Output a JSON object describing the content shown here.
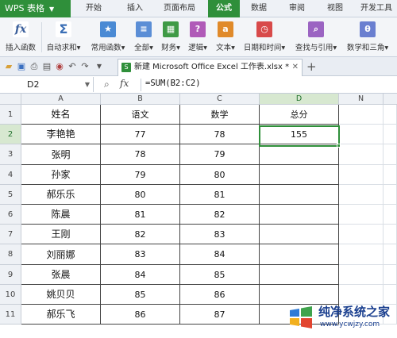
{
  "app": {
    "title": "WPS 表格"
  },
  "menu": {
    "tabs": [
      {
        "label": "开始"
      },
      {
        "label": "插入"
      },
      {
        "label": "页面布局"
      },
      {
        "label": "公式",
        "active": true
      },
      {
        "label": "数据"
      },
      {
        "label": "审阅"
      },
      {
        "label": "视图"
      },
      {
        "label": "开发工具"
      }
    ]
  },
  "ribbon": {
    "buttons": [
      {
        "label": "插入函数",
        "icon": "fx-icon",
        "color": "#5b7fb8"
      },
      {
        "label": "自动求和",
        "icon": "sigma-icon",
        "color": "#3b6fb6"
      },
      {
        "label": "常用函数",
        "icon": "star-icon",
        "color": "#4a8ad4"
      },
      {
        "label": "全部",
        "icon": "list-icon",
        "color": "#5b8ed6"
      },
      {
        "label": "财务",
        "icon": "finance-icon",
        "color": "#3f9a46"
      },
      {
        "label": "逻辑",
        "icon": "logic-icon",
        "color": "#b05ab8"
      },
      {
        "label": "文本",
        "icon": "text-icon",
        "color": "#e08a2a"
      },
      {
        "label": "日期和时间",
        "icon": "clock-icon",
        "color": "#d84a4a"
      },
      {
        "label": "查找与引用",
        "icon": "lookup-icon",
        "color": "#9b64c2"
      },
      {
        "label": "数学和三角",
        "icon": "math-icon",
        "color": "#6a7fd0"
      }
    ]
  },
  "document": {
    "tab_title": "新建 Microsoft Office Excel 工作表.xlsx *"
  },
  "formula_bar": {
    "cell_ref": "D2",
    "formula": "=SUM(B2:C2)"
  },
  "sheet": {
    "columns": [
      "A",
      "B",
      "C",
      "D",
      "N"
    ],
    "headers": [
      "姓名",
      "语文",
      "数学",
      "总分"
    ],
    "rows": [
      {
        "n": "2",
        "name": "李艳艳",
        "yuwen": "77",
        "shuxue": "78",
        "total": "155"
      },
      {
        "n": "3",
        "name": "张明",
        "yuwen": "78",
        "shuxue": "79",
        "total": ""
      },
      {
        "n": "4",
        "name": "孙家",
        "yuwen": "79",
        "shuxue": "80",
        "total": ""
      },
      {
        "n": "5",
        "name": "郝乐乐",
        "yuwen": "80",
        "shuxue": "81",
        "total": ""
      },
      {
        "n": "6",
        "name": "陈晨",
        "yuwen": "81",
        "shuxue": "82",
        "total": ""
      },
      {
        "n": "7",
        "name": "王刚",
        "yuwen": "82",
        "shuxue": "83",
        "total": ""
      },
      {
        "n": "8",
        "name": "刘丽娜",
        "yuwen": "83",
        "shuxue": "84",
        "total": ""
      },
      {
        "n": "9",
        "name": "张晨",
        "yuwen": "84",
        "shuxue": "85",
        "total": ""
      },
      {
        "n": "10",
        "name": "姚贝贝",
        "yuwen": "85",
        "shuxue": "86",
        "total": ""
      },
      {
        "n": "11",
        "name": "郝乐飞",
        "yuwen": "86",
        "shuxue": "87",
        "total": ""
      }
    ],
    "header_row_number": "1"
  },
  "watermark": {
    "title": "纯净系统之家",
    "url": "www.ycwjzy.com"
  },
  "colors": {
    "accent": "#2f8f3a"
  }
}
